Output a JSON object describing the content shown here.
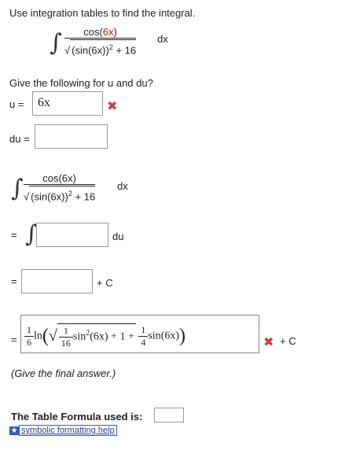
{
  "instruction": "Use integration tables to find the integral.",
  "problem": {
    "cos": "cos(",
    "arg": "6x",
    "close": ")",
    "den": "(sin(6x))",
    "sup": "2",
    "plus16": "+ 16",
    "dx": "dx"
  },
  "prompt": "Give the following for u and du?",
  "u": {
    "label": "u =",
    "value": "6x"
  },
  "du": {
    "label": "du =",
    "value": ""
  },
  "step2": {
    "num": "cos(6x)",
    "den": "(sin(6x))",
    "sup": "2",
    "plus16": "+ 16",
    "dx": "dx"
  },
  "step3": {
    "eq": "=",
    "dx": "du",
    "value": ""
  },
  "step4": {
    "eq": "=",
    "value": "",
    "plus_c": "+ C"
  },
  "final": {
    "eq": "=",
    "one": "1",
    "six": "6",
    "ln": "ln",
    "sixteen": "16",
    "sin2": "sin",
    "sup": "2",
    "arg": "(6x) + 1 +",
    "four": "4",
    "sin": "sin",
    "arg2": "(6x)",
    "plus_c": "+ C"
  },
  "give_final": "(Give the final answer.)",
  "table_formula": {
    "label": "The Table Formula used is:",
    "value": ""
  },
  "help": {
    "label": "symbolic formatting help",
    "icon": "star-icon"
  },
  "colors": {
    "red": "#c21807",
    "x_mark": "#d23b3b",
    "link": "#2a3f9a"
  }
}
